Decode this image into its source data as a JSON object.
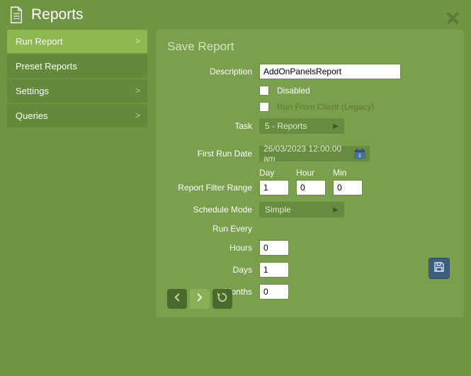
{
  "window": {
    "title": "Reports"
  },
  "sidebar": {
    "items": [
      {
        "label": "Run Report",
        "active": true,
        "expandable": true
      },
      {
        "label": "Preset Reports",
        "active": false,
        "expandable": false
      },
      {
        "label": "Settings",
        "active": false,
        "expandable": true
      },
      {
        "label": "Queries",
        "active": false,
        "expandable": true
      }
    ]
  },
  "form": {
    "section_title": "Save Report",
    "labels": {
      "description": "Description",
      "disabled": "Disabled",
      "run_from_client": "Run From Client (Legacy)",
      "task": "Task",
      "first_run_date": "First Run Date",
      "report_filter_range": "Report Filter Range",
      "schedule_mode": "Schedule Mode",
      "run_every": "Run Every",
      "hours": "Hours",
      "days": "Days",
      "months": "Months",
      "day": "Day",
      "hour": "Hour",
      "min": "Min"
    },
    "values": {
      "description": "AddOnPanelsReport",
      "disabled": false,
      "run_from_client": false,
      "task": "5 - Reports",
      "first_run_date": "26/03/2023 12:00:00 am",
      "filter_day": "1",
      "filter_hour": "0",
      "filter_min": "0",
      "schedule_mode": "Simple",
      "every_hours": "0",
      "every_days": "1",
      "every_months": "0"
    }
  }
}
